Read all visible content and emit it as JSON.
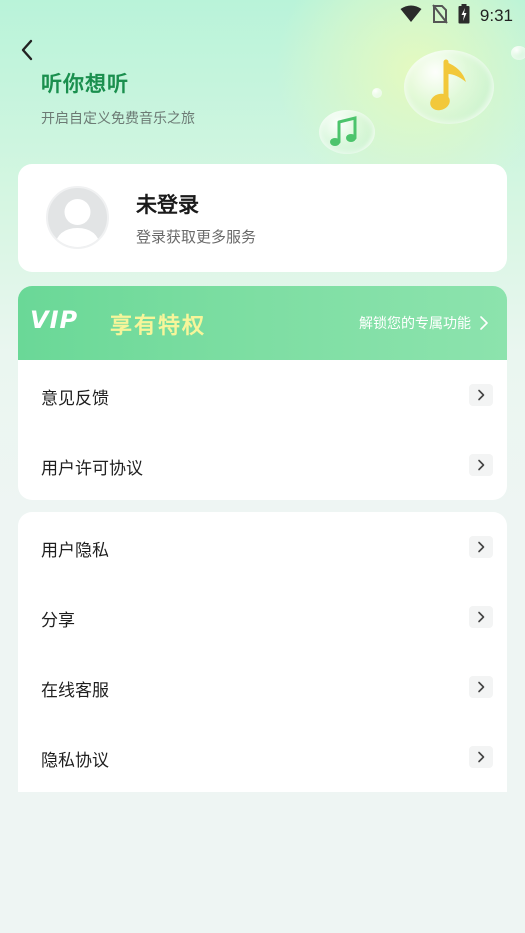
{
  "status_bar": {
    "time": "9:31",
    "icons": [
      "wifi-icon",
      "no-sim-icon",
      "battery-charging-icon"
    ]
  },
  "header": {
    "back_icon": "chevron-left-icon",
    "title": "听你想听",
    "subtitle": "开启自定义免费音乐之旅",
    "decor_icons": [
      "music-note-icon",
      "double-music-note-icon"
    ]
  },
  "profile": {
    "name": "未登录",
    "subtitle": "登录获取更多服务",
    "avatar_icon": "default-avatar-icon"
  },
  "vip": {
    "logo": "VIP",
    "title": "享有特权",
    "description": "解锁您的专属功能",
    "arrow_icon": "chevron-right-icon"
  },
  "menu_group_1": [
    {
      "label": "意见反馈"
    },
    {
      "label": "用户许可协议"
    }
  ],
  "menu_group_2": [
    {
      "label": "用户隐私"
    },
    {
      "label": "分享"
    },
    {
      "label": "在线客服"
    },
    {
      "label": "隐私协议"
    }
  ],
  "colors": {
    "accent_green": "#1a8f4e",
    "vip_gradient_start": "#6ad897",
    "vip_gradient_end": "#8ce3ad",
    "vip_title": "#f7f59a",
    "page_bg": "#eef5f3"
  }
}
